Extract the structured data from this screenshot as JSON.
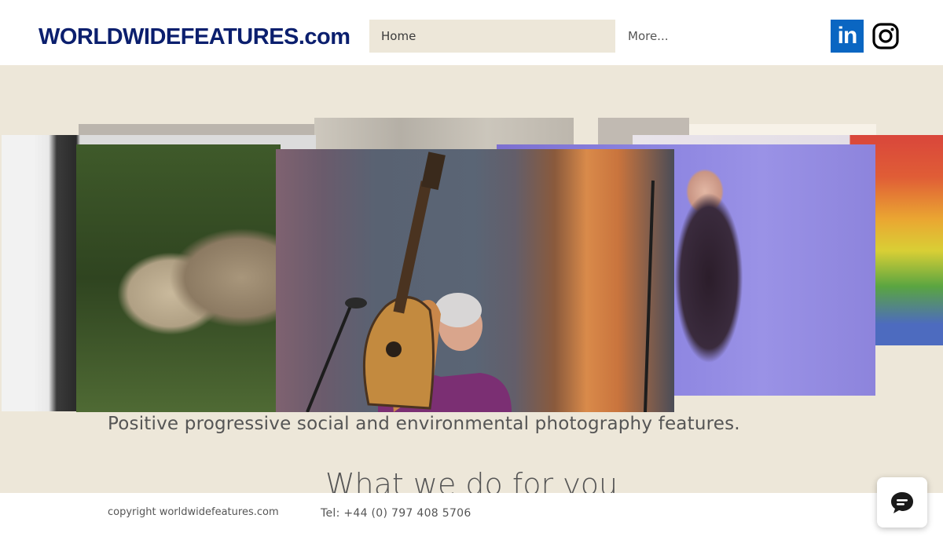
{
  "header": {
    "logo": "WORLDWIDEFEATURES.com",
    "nav": [
      {
        "label": "Home",
        "active": true
      },
      {
        "label": "More...",
        "active": false
      }
    ],
    "social": [
      {
        "icon": "linkedin-icon",
        "label": "in",
        "color": "#0a66c2"
      },
      {
        "icon": "instagram-icon",
        "color": "#000000"
      }
    ]
  },
  "gallery": {
    "slides": [
      {
        "subject": "lioness",
        "icon": "lioness-photo"
      },
      {
        "subject": "woman with guitar",
        "icon": "guitar-performer-photo"
      },
      {
        "subject": "woman in dress",
        "icon": "portrait-photo"
      },
      {
        "subject": "rainbow flag",
        "icon": "rainbow-flag-photo"
      }
    ]
  },
  "main": {
    "caption": "Positive progressive social and environmental photography features.",
    "section_title": "What we do for you"
  },
  "footer": {
    "copyright": "copyright worldwidefeatures.com",
    "tel": "Tel: +44 (0) 797 408 5706"
  },
  "chat": {
    "icon": "chat-bubble-icon"
  },
  "colors": {
    "page_bg": "#ede7d9",
    "logo": "#0b1f6e",
    "nav_active_bg": "#ede7d9",
    "text": "#555555"
  }
}
